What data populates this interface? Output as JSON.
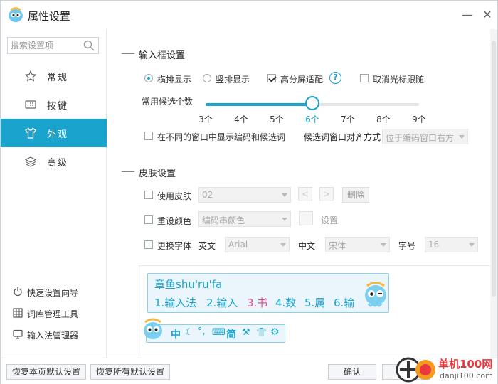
{
  "window": {
    "title": "属性设置",
    "minimize": "—",
    "close": "✕"
  },
  "sidebar": {
    "search_placeholder": "搜索设置项",
    "items": [
      {
        "label": "常规",
        "icon": "star-icon"
      },
      {
        "label": "按键",
        "icon": "keyboard-icon"
      },
      {
        "label": "外观",
        "icon": "shirt-icon"
      },
      {
        "label": "高级",
        "icon": "layers-icon"
      }
    ],
    "active_index": 2,
    "tools": [
      {
        "label": "快速设置向导",
        "icon": "power-icon"
      },
      {
        "label": "词库管理工具",
        "icon": "grid-icon"
      },
      {
        "label": "输入法管理器",
        "icon": "monitor-icon"
      }
    ]
  },
  "input_box": {
    "section_title": "输入框设置",
    "layout_options": [
      "横排显示",
      "竖排显示"
    ],
    "layout_selected": "横排显示",
    "hidpi_label": "高分屏适配",
    "hidpi_checked": true,
    "help": "?",
    "cancel_cursor_label": "取消光标跟随",
    "cancel_cursor_checked": false,
    "candidate_count_label": "常用候选个数",
    "candidate_ticks": [
      "3个",
      "4个",
      "5个",
      "6个",
      "7个",
      "8个",
      "9个"
    ],
    "candidate_selected": "6个",
    "candidate_count_value": 6,
    "multi_window_label": "在不同的窗口中显示编码和候选词",
    "multi_window_checked": false,
    "align_label": "候选词窗口对齐方式",
    "align_value": "位于编码窗口右方"
  },
  "skin": {
    "section_title": "皮肤设置",
    "use_skin_label": "使用皮肤",
    "skin_value": "02",
    "prev": "<",
    "next": ">",
    "delete_label": "删除",
    "reset_color_label": "重设颜色",
    "color_value": "编码串颜色",
    "setting_label": "设置",
    "change_font_label": "更换字体",
    "en_label": "英文",
    "en_font": "Arial",
    "cn_label": "中文",
    "cn_font": "宋体",
    "size_label": "字号",
    "size_value": "16"
  },
  "preview": {
    "pinyin": "章鱼shu'ru'fa",
    "candidates": [
      "1.输入法",
      "2.输入",
      "3.书",
      "4.数",
      "5.属",
      "6.输"
    ],
    "highlight_index": 2,
    "status_items": [
      "中",
      "☾",
      "°,",
      "⌨",
      "简",
      "⚒",
      "👕",
      "⚙"
    ]
  },
  "footer": {
    "restore_page": "恢复本页默认设置",
    "restore_all": "恢复所有默认设置",
    "ok": "确认",
    "apply": "应用"
  },
  "watermark": {
    "text": "单机100网",
    "url": "danji100.com"
  },
  "colors": {
    "accent": "#1aa3cc",
    "highlight": "#e0468a",
    "watermark": "#e8383d"
  }
}
